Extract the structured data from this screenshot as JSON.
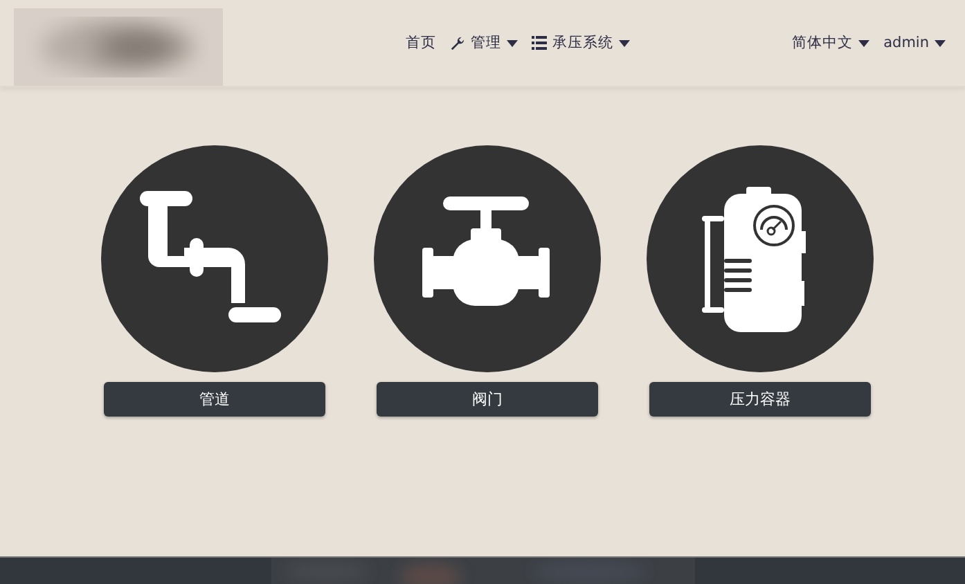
{
  "navbar": {
    "menu": [
      {
        "label": "首页",
        "kind": "plain",
        "dropdown": false
      },
      {
        "label": "管理",
        "kind": "wrench",
        "dropdown": true
      },
      {
        "label": "承压系统",
        "kind": "list",
        "dropdown": true
      }
    ],
    "right_menu": [
      {
        "label": "简体中文",
        "dropdown": true
      },
      {
        "label": "admin",
        "dropdown": true
      }
    ]
  },
  "tiles": [
    {
      "kind": "pipe",
      "label": "管道"
    },
    {
      "kind": "valve",
      "label": "阀门"
    },
    {
      "kind": "vessel",
      "label": "压力容器"
    }
  ]
}
